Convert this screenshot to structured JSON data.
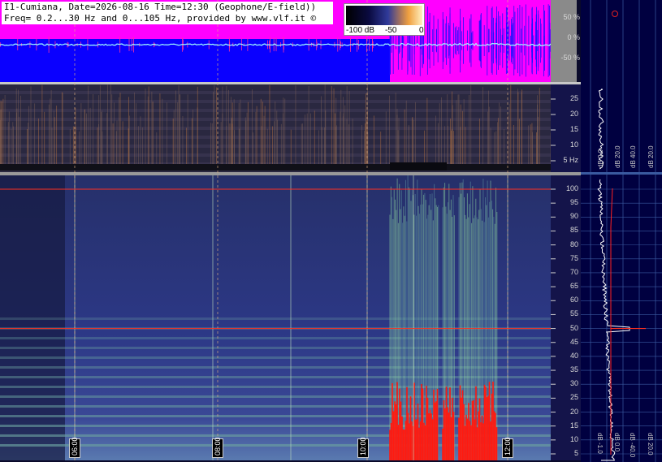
{
  "header": {
    "line1": "I1-Cumiana, Date=2026-08-16 Time=12:30 (Geophone/E-field))",
    "line2": "Freq= 0.2...30 Hz and 0...105 Hz, provided by www.vlf.it ©"
  },
  "colorbar": {
    "labels": [
      "-100 dB",
      "-50",
      "0"
    ]
  },
  "chart_data": [
    {
      "type": "line",
      "panel": "waveform",
      "ylabel": "%",
      "yticks": [
        "50 %",
        "0 %",
        "-50 %"
      ],
      "colors": {
        "background_left": "#0a00ff",
        "background_right": "#ff00ff",
        "trace": "#a0ffff"
      }
    },
    {
      "type": "heatmap",
      "panel": "low-frequency spectrogram",
      "yrange": [
        0.2,
        30
      ],
      "yticks": [
        "25",
        "20",
        "15",
        "10",
        "5 Hz"
      ],
      "ytick_values": [
        25,
        20,
        15,
        10,
        5
      ]
    },
    {
      "type": "heatmap",
      "panel": "high-frequency spectrogram",
      "yrange": [
        0,
        105
      ],
      "yticks": [
        "100",
        "95",
        "90",
        "85",
        "80",
        "75",
        "70",
        "65",
        "60",
        "55",
        "50",
        "45",
        "40",
        "35",
        "30",
        "25",
        "20",
        "15",
        "10",
        "5"
      ],
      "ytick_values": [
        100,
        95,
        90,
        85,
        80,
        75,
        70,
        65,
        60,
        55,
        50,
        45,
        40,
        35,
        30,
        25,
        20,
        15,
        10,
        5
      ],
      "hlines": [
        100,
        50
      ],
      "time_labels": [
        "06:00",
        "08:00",
        "10:00",
        "12:00"
      ]
    },
    {
      "type": "line",
      "panel": "power profile",
      "top_labels": [
        "dB 0.0",
        "dB 20.0",
        "dB 40.0",
        "dB 20.0"
      ],
      "bottom_labels": [
        "dB -1.0",
        "dB 0.0",
        "dB -40.0",
        "dB 20.0"
      ]
    }
  ]
}
